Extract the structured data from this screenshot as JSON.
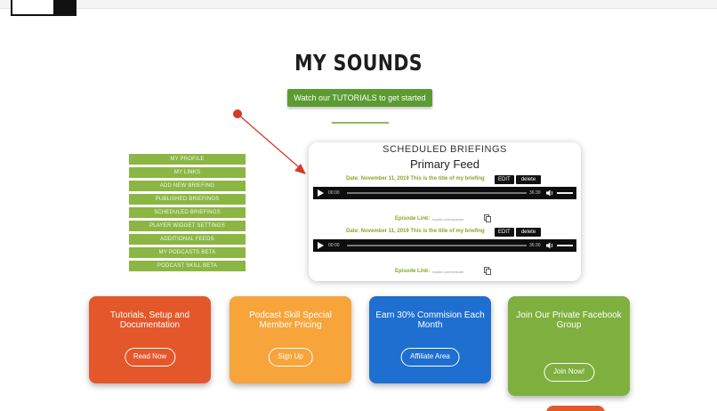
{
  "page": {
    "title": "MY SOUNDS",
    "tutorial_button": "Watch our TUTORIALS to get started"
  },
  "menu": {
    "items": [
      "MY PROFILE",
      "MY LINKS",
      "ADD NEW BRIEFING",
      "PUBLISHED BRIEFINGS",
      "SCHEDULED BRIEFINGS",
      "PLAYER WIDGET SETTINGS",
      "ADDITIONAL FEEDS",
      "MY PODCASTS BETA",
      "PODCAST SKILL BETA"
    ]
  },
  "briefings": {
    "heading": "SCHEDULED BRIEFINGS",
    "feed": "Primary Feed",
    "edit_label": "EDIT",
    "delete_label": "delete",
    "episode_link_label": "Episode Link:",
    "episodes": [
      {
        "title": "Date: November 11, 2019  This is the title of my briefing",
        "time_start": "00:00",
        "time_end": "36:30",
        "url": "mysite.com/episode"
      },
      {
        "title": "Date: November 11, 2019  This is the title of my briefing",
        "time_start": "00:00",
        "time_end": "36:30",
        "url": "mysite.com/episode"
      }
    ]
  },
  "promos": [
    {
      "text": "Tutorials, Setup and Documentation",
      "button": "Read Now",
      "color": "#e4572a"
    },
    {
      "text": "Podcast Skill Special Member Pricing",
      "button": "Sign Up",
      "color": "#f7a43a"
    },
    {
      "text": "Earn 30% Commision Each Month",
      "button": "Affiliate Area",
      "color": "#1e6fd0"
    },
    {
      "text": "Join Our Private Facebook Group",
      "button": "Join Now!",
      "color": "#7fb03f"
    }
  ],
  "colors": {
    "accent_green": "#5b9b31",
    "menu_green": "#8bb644",
    "arrow_red": "#d23b2b"
  }
}
